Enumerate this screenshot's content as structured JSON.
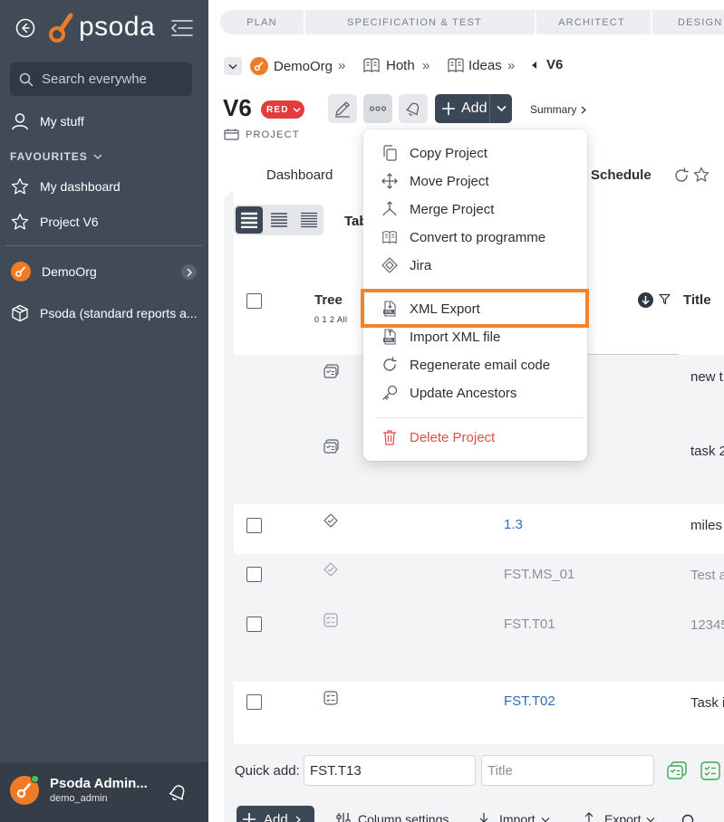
{
  "sidebar": {
    "logo_text": "psoda",
    "search_placeholder": "Search everywhe",
    "my_stuff": "My stuff",
    "favourites_label": "FAVOURITES",
    "favourites": [
      "My dashboard",
      "Project V6"
    ],
    "org": "DemoOrg",
    "reports": "Psoda (standard reports a...",
    "user_name": "Psoda Admin...",
    "user_login": "demo_admin"
  },
  "stages": [
    "PLAN",
    "SPECIFICATION & TEST",
    "ARCHITECT",
    "DESIGN"
  ],
  "breadcrumb": [
    "DemoOrg",
    "Hoth",
    "Ideas",
    "V6"
  ],
  "project": {
    "title": "V6",
    "status_badge": "RED",
    "type_label": "PROJECT",
    "add_label": "Add",
    "summary_label": "Summary"
  },
  "tabs": [
    "Dashboard",
    "Schedule"
  ],
  "table": {
    "view_label": "Tab",
    "headers": {
      "tree": "Tree",
      "levels": "0 1 2 All",
      "title": "Title"
    },
    "rows": [
      {
        "id": "",
        "title": "new t",
        "icon": "task-icon",
        "checkbox": false,
        "muted": false
      },
      {
        "id": "",
        "title": "task 2",
        "icon": "task-icon",
        "checkbox": false,
        "muted": false
      },
      {
        "id": "1.3",
        "title": "miles",
        "icon": "milestone-icon",
        "checkbox": true,
        "muted": false
      },
      {
        "id": "FST.MS_01",
        "title": "Test a",
        "icon": "milestone-icon",
        "checkbox": true,
        "muted": true
      },
      {
        "id": "FST.T01",
        "title": "12345",
        "icon": "task-list-icon",
        "checkbox": true,
        "muted": true
      },
      {
        "id": "FST.T02",
        "title": "Task i",
        "icon": "task-list-icon",
        "checkbox": true,
        "muted": false
      }
    ]
  },
  "quick_add": {
    "label": "Quick add:",
    "id_value": "FST.T13",
    "title_placeholder": "Title"
  },
  "bottom_toolbar": {
    "add": "Add",
    "column_settings": "Column settings",
    "import": "Import",
    "export": "Export"
  },
  "menu": {
    "items": [
      "Copy Project",
      "Move Project",
      "Merge Project",
      "Convert to programme",
      "Jira",
      "XML Export",
      "Import XML file",
      "Regenerate email code",
      "Update Ancestors"
    ],
    "danger_item": "Delete Project",
    "highlighted": "XML Export"
  },
  "colors": {
    "sidebar": "#414a57",
    "accent_orange": "#f07b26",
    "status_red": "#e23c3c",
    "link_blue": "#2c6fb7",
    "highlight": "#f2832c"
  }
}
